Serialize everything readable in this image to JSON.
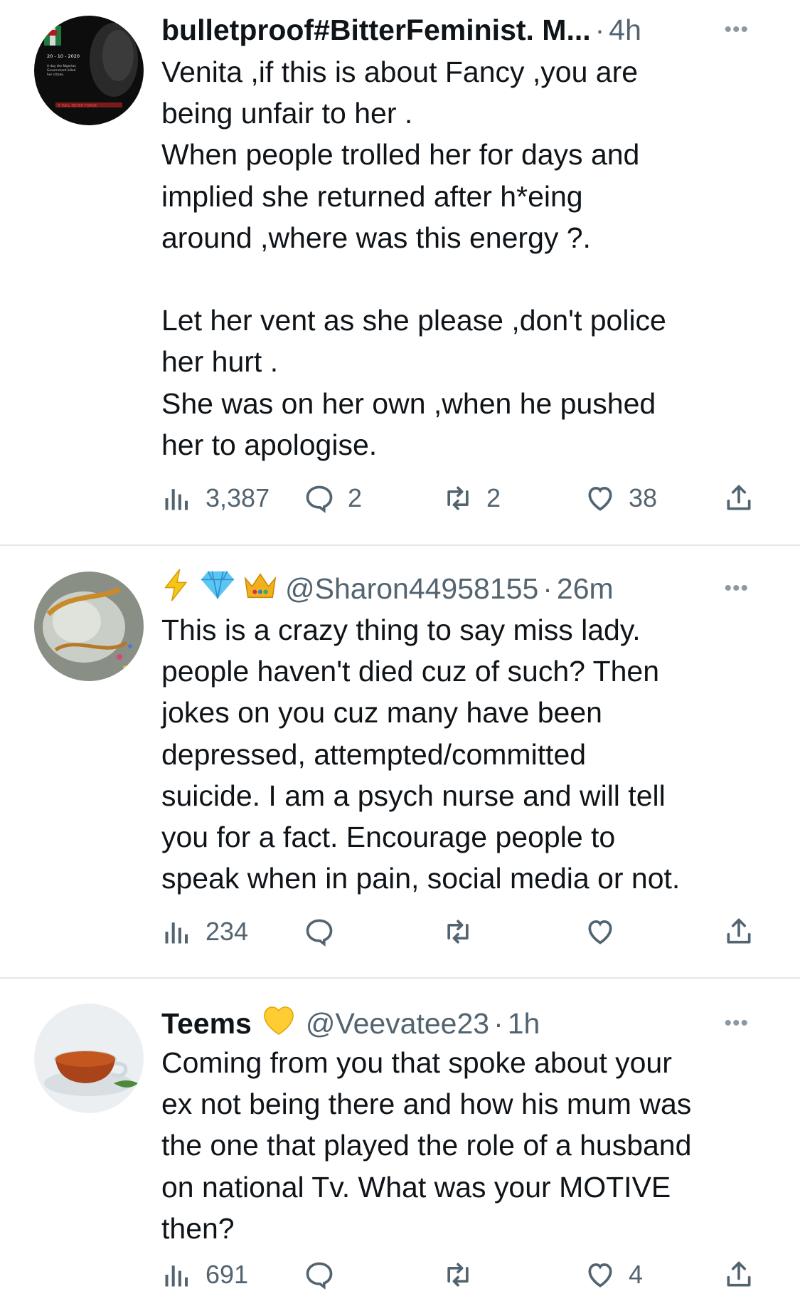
{
  "tweets": [
    {
      "name": "bulletproof#BitterFeminist. M...",
      "handle": "",
      "time": "4h",
      "avatar_text": {
        "date": "20 - 10 - 2020",
        "line1": "A day the Nigerian",
        "line2": "Government killed",
        "line3": "her citizen.",
        "bottom": "E WILL NEVER FORGE"
      },
      "text": "Venita ,if this is about Fancy ,you are\nbeing unfair to her .\nWhen people trolled her for days and\nimplied she returned after h*eing\naround ,where was this energy ?.\n\nLet her vent as she please ,don't police\nher hurt .\nShe was on her own ,when he pushed\nher to apologise.",
      "views": "3,387",
      "replies": "2",
      "retweets": "2",
      "likes": "38"
    },
    {
      "name": "",
      "handle": "@Sharon44958155",
      "time": "26m",
      "name_emojis": [
        "lightning-emoji",
        "gem-emoji",
        "crown-emoji"
      ],
      "text": "This is a crazy thing to say miss lady.\npeople haven't died cuz of such? Then\njokes on you cuz many have been\ndepressed, attempted/committed\nsuicide. I am a psych nurse and will tell\nyou for a fact. Encourage people to\nspeak when in pain, social media or not.",
      "views": "234",
      "replies": "",
      "retweets": "",
      "likes": ""
    },
    {
      "name": "Teems",
      "handle": "@Veevatee23",
      "time": "1h",
      "name_emojis": [
        "yellow-heart-emoji"
      ],
      "text": "Coming from you that spoke about your\nex not being there and how his mum was\nthe one that played the role of a husband\non national Tv. What was your MOTIVE\nthen?",
      "views": "691",
      "replies": "",
      "retweets": "",
      "likes": "4"
    }
  ],
  "dot_separator": "·",
  "more_glyph": "•••",
  "colors": {
    "text": "#0f1419",
    "secondary": "#536471",
    "separator": "#e3e6e9",
    "icon": "#536471"
  }
}
